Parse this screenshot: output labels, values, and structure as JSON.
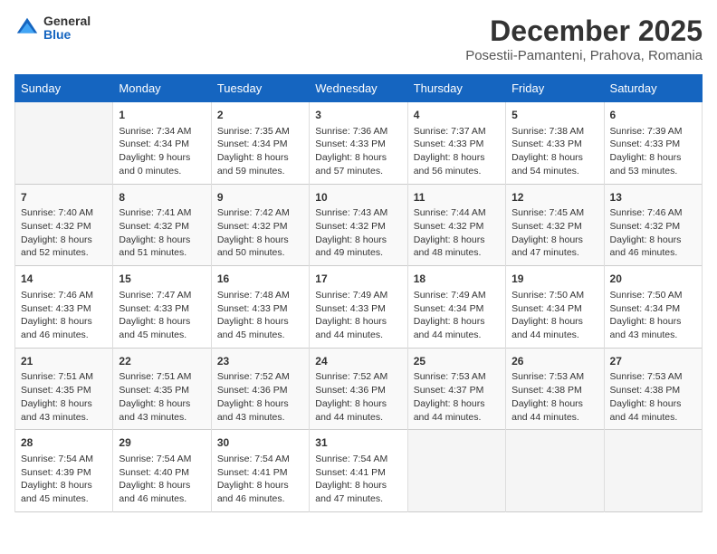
{
  "header": {
    "logo_general": "General",
    "logo_blue": "Blue",
    "month_title": "December 2025",
    "subtitle": "Posestii-Pamanteni, Prahova, Romania"
  },
  "days_of_week": [
    "Sunday",
    "Monday",
    "Tuesday",
    "Wednesday",
    "Thursday",
    "Friday",
    "Saturday"
  ],
  "weeks": [
    [
      {
        "day": "",
        "info": ""
      },
      {
        "day": "1",
        "info": "Sunrise: 7:34 AM\nSunset: 4:34 PM\nDaylight: 9 hours\nand 0 minutes."
      },
      {
        "day": "2",
        "info": "Sunrise: 7:35 AM\nSunset: 4:34 PM\nDaylight: 8 hours\nand 59 minutes."
      },
      {
        "day": "3",
        "info": "Sunrise: 7:36 AM\nSunset: 4:33 PM\nDaylight: 8 hours\nand 57 minutes."
      },
      {
        "day": "4",
        "info": "Sunrise: 7:37 AM\nSunset: 4:33 PM\nDaylight: 8 hours\nand 56 minutes."
      },
      {
        "day": "5",
        "info": "Sunrise: 7:38 AM\nSunset: 4:33 PM\nDaylight: 8 hours\nand 54 minutes."
      },
      {
        "day": "6",
        "info": "Sunrise: 7:39 AM\nSunset: 4:33 PM\nDaylight: 8 hours\nand 53 minutes."
      }
    ],
    [
      {
        "day": "7",
        "info": "Sunrise: 7:40 AM\nSunset: 4:32 PM\nDaylight: 8 hours\nand 52 minutes."
      },
      {
        "day": "8",
        "info": "Sunrise: 7:41 AM\nSunset: 4:32 PM\nDaylight: 8 hours\nand 51 minutes."
      },
      {
        "day": "9",
        "info": "Sunrise: 7:42 AM\nSunset: 4:32 PM\nDaylight: 8 hours\nand 50 minutes."
      },
      {
        "day": "10",
        "info": "Sunrise: 7:43 AM\nSunset: 4:32 PM\nDaylight: 8 hours\nand 49 minutes."
      },
      {
        "day": "11",
        "info": "Sunrise: 7:44 AM\nSunset: 4:32 PM\nDaylight: 8 hours\nand 48 minutes."
      },
      {
        "day": "12",
        "info": "Sunrise: 7:45 AM\nSunset: 4:32 PM\nDaylight: 8 hours\nand 47 minutes."
      },
      {
        "day": "13",
        "info": "Sunrise: 7:46 AM\nSunset: 4:32 PM\nDaylight: 8 hours\nand 46 minutes."
      }
    ],
    [
      {
        "day": "14",
        "info": "Sunrise: 7:46 AM\nSunset: 4:33 PM\nDaylight: 8 hours\nand 46 minutes."
      },
      {
        "day": "15",
        "info": "Sunrise: 7:47 AM\nSunset: 4:33 PM\nDaylight: 8 hours\nand 45 minutes."
      },
      {
        "day": "16",
        "info": "Sunrise: 7:48 AM\nSunset: 4:33 PM\nDaylight: 8 hours\nand 45 minutes."
      },
      {
        "day": "17",
        "info": "Sunrise: 7:49 AM\nSunset: 4:33 PM\nDaylight: 8 hours\nand 44 minutes."
      },
      {
        "day": "18",
        "info": "Sunrise: 7:49 AM\nSunset: 4:34 PM\nDaylight: 8 hours\nand 44 minutes."
      },
      {
        "day": "19",
        "info": "Sunrise: 7:50 AM\nSunset: 4:34 PM\nDaylight: 8 hours\nand 44 minutes."
      },
      {
        "day": "20",
        "info": "Sunrise: 7:50 AM\nSunset: 4:34 PM\nDaylight: 8 hours\nand 43 minutes."
      }
    ],
    [
      {
        "day": "21",
        "info": "Sunrise: 7:51 AM\nSunset: 4:35 PM\nDaylight: 8 hours\nand 43 minutes."
      },
      {
        "day": "22",
        "info": "Sunrise: 7:51 AM\nSunset: 4:35 PM\nDaylight: 8 hours\nand 43 minutes."
      },
      {
        "day": "23",
        "info": "Sunrise: 7:52 AM\nSunset: 4:36 PM\nDaylight: 8 hours\nand 43 minutes."
      },
      {
        "day": "24",
        "info": "Sunrise: 7:52 AM\nSunset: 4:36 PM\nDaylight: 8 hours\nand 44 minutes."
      },
      {
        "day": "25",
        "info": "Sunrise: 7:53 AM\nSunset: 4:37 PM\nDaylight: 8 hours\nand 44 minutes."
      },
      {
        "day": "26",
        "info": "Sunrise: 7:53 AM\nSunset: 4:38 PM\nDaylight: 8 hours\nand 44 minutes."
      },
      {
        "day": "27",
        "info": "Sunrise: 7:53 AM\nSunset: 4:38 PM\nDaylight: 8 hours\nand 44 minutes."
      }
    ],
    [
      {
        "day": "28",
        "info": "Sunrise: 7:54 AM\nSunset: 4:39 PM\nDaylight: 8 hours\nand 45 minutes."
      },
      {
        "day": "29",
        "info": "Sunrise: 7:54 AM\nSunset: 4:40 PM\nDaylight: 8 hours\nand 46 minutes."
      },
      {
        "day": "30",
        "info": "Sunrise: 7:54 AM\nSunset: 4:41 PM\nDaylight: 8 hours\nand 46 minutes."
      },
      {
        "day": "31",
        "info": "Sunrise: 7:54 AM\nSunset: 4:41 PM\nDaylight: 8 hours\nand 47 minutes."
      },
      {
        "day": "",
        "info": ""
      },
      {
        "day": "",
        "info": ""
      },
      {
        "day": "",
        "info": ""
      }
    ]
  ]
}
